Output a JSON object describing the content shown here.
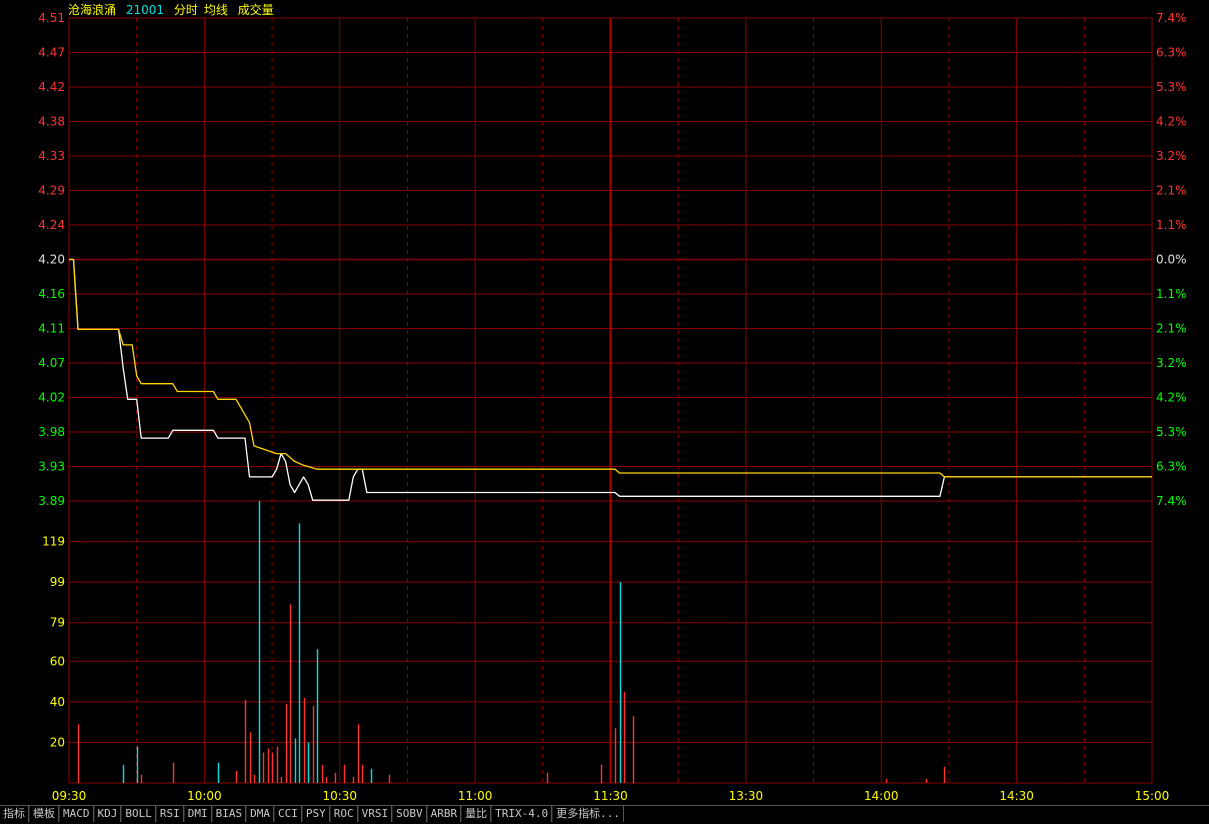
{
  "header": {
    "stock_name": "沧海浪涌",
    "stock_code": "21001",
    "mode": "分时",
    "avg_label": "均线",
    "vol_label": "成交量"
  },
  "tabs": [
    "指标",
    "模板",
    "MACD",
    "KDJ",
    "BOLL",
    "RSI",
    "DMI",
    "BIAS",
    "DMA",
    "CCI",
    "PSY",
    "ROC",
    "VRSI",
    "SOBV",
    "ARBR",
    "量比",
    "TRIX-4.0",
    "更多指标..."
  ],
  "colors": {
    "grid": "#8b0000",
    "up": "#ff3232",
    "down": "#00ff00",
    "flat": "#e0e0e0",
    "price_line": "#ffffff",
    "avg_line": "#ffd700",
    "vol_up": "#ff3232",
    "vol_down": "#00e0e0",
    "time_label": "#ffff00"
  },
  "chart_data": {
    "type": "line",
    "title": "",
    "prev_close": 4.2,
    "price_ticks": [
      "4.51",
      "4.47",
      "4.42",
      "4.38",
      "4.33",
      "4.29",
      "4.24",
      "4.20",
      "4.16",
      "4.11",
      "4.07",
      "4.02",
      "3.98",
      "3.93",
      "3.89"
    ],
    "pct_ticks": [
      "7.4%",
      "6.3%",
      "5.3%",
      "4.2%",
      "3.2%",
      "2.1%",
      "1.1%",
      "0.0%",
      "1.1%",
      "2.1%",
      "3.2%",
      "4.2%",
      "5.3%",
      "6.3%",
      "7.4%"
    ],
    "volume_ticks": [
      "119",
      "99",
      "79",
      "60",
      "40",
      "20"
    ],
    "volume_ylim": [
      0,
      139
    ],
    "price_ylim": [
      3.889,
      4.511
    ],
    "time_labels": [
      "09:30",
      "10:00",
      "10:30",
      "11:00",
      "11:30",
      "13:30",
      "14:00",
      "14:30",
      "15:00"
    ],
    "x_range": [
      0,
      240
    ],
    "series": [
      {
        "values": [
          [
            0,
            4.2
          ],
          [
            1,
            4.2
          ],
          [
            2,
            4.11
          ],
          [
            11,
            4.11
          ],
          [
            12,
            4.06
          ],
          [
            13,
            4.02
          ],
          [
            15,
            4.02
          ],
          [
            16,
            3.97
          ],
          [
            22,
            3.97
          ],
          [
            23,
            3.98
          ],
          [
            32,
            3.98
          ],
          [
            33,
            3.97
          ],
          [
            39,
            3.97
          ],
          [
            40,
            3.92
          ],
          [
            45,
            3.92
          ],
          [
            46,
            3.93
          ],
          [
            47,
            3.95
          ],
          [
            48,
            3.94
          ],
          [
            49,
            3.91
          ],
          [
            50,
            3.9
          ],
          [
            51,
            3.91
          ],
          [
            52,
            3.92
          ],
          [
            53,
            3.91
          ],
          [
            54,
            3.89
          ],
          [
            62,
            3.89
          ],
          [
            63,
            3.92
          ],
          [
            64,
            3.93
          ],
          [
            65,
            3.93
          ],
          [
            66,
            3.9
          ],
          [
            121,
            3.9
          ],
          [
            122,
            3.895
          ],
          [
            193,
            3.895
          ],
          [
            194,
            3.92
          ],
          [
            240,
            3.92
          ]
        ]
      },
      {
        "values": [
          [
            0,
            4.2
          ],
          [
            1,
            4.2
          ],
          [
            2,
            4.11
          ],
          [
            11,
            4.11
          ],
          [
            12,
            4.09
          ],
          [
            14,
            4.09
          ],
          [
            15,
            4.05
          ],
          [
            16,
            4.04
          ],
          [
            23,
            4.04
          ],
          [
            24,
            4.03
          ],
          [
            32,
            4.03
          ],
          [
            33,
            4.02
          ],
          [
            37,
            4.02
          ],
          [
            38,
            4.01
          ],
          [
            39,
            4.0
          ],
          [
            40,
            3.99
          ],
          [
            41,
            3.96
          ],
          [
            46,
            3.95
          ],
          [
            48,
            3.95
          ],
          [
            50,
            3.94
          ],
          [
            52,
            3.935
          ],
          [
            55,
            3.93
          ],
          [
            60,
            3.93
          ],
          [
            121,
            3.93
          ],
          [
            122,
            3.925
          ],
          [
            193,
            3.925
          ],
          [
            194,
            3.92
          ],
          [
            240,
            3.92
          ]
        ]
      }
    ],
    "volume": [
      {
        "x": 2,
        "v": 29,
        "dir": "up"
      },
      {
        "x": 12,
        "v": 9,
        "dir": "down"
      },
      {
        "x": 15,
        "v": 18,
        "dir": "down"
      },
      {
        "x": 16,
        "v": 4,
        "dir": "up"
      },
      {
        "x": 23,
        "v": 10,
        "dir": "up"
      },
      {
        "x": 33,
        "v": 10,
        "dir": "down"
      },
      {
        "x": 37,
        "v": 6,
        "dir": "up"
      },
      {
        "x": 39,
        "v": 41,
        "dir": "up"
      },
      {
        "x": 40,
        "v": 25,
        "dir": "up"
      },
      {
        "x": 41,
        "v": 4,
        "dir": "up"
      },
      {
        "x": 42,
        "v": 139,
        "dir": "down"
      },
      {
        "x": 43,
        "v": 15,
        "dir": "up"
      },
      {
        "x": 44,
        "v": 17,
        "dir": "up"
      },
      {
        "x": 45,
        "v": 15,
        "dir": "up"
      },
      {
        "x": 46,
        "v": 18,
        "dir": "up"
      },
      {
        "x": 47,
        "v": 3,
        "dir": "up"
      },
      {
        "x": 48,
        "v": 39,
        "dir": "up"
      },
      {
        "x": 49,
        "v": 88,
        "dir": "up"
      },
      {
        "x": 50,
        "v": 22,
        "dir": "down"
      },
      {
        "x": 51,
        "v": 128,
        "dir": "down"
      },
      {
        "x": 52,
        "v": 42,
        "dir": "up"
      },
      {
        "x": 53,
        "v": 20,
        "dir": "down"
      },
      {
        "x": 54,
        "v": 38,
        "dir": "up"
      },
      {
        "x": 55,
        "v": 66,
        "dir": "down"
      },
      {
        "x": 56,
        "v": 9,
        "dir": "up"
      },
      {
        "x": 57,
        "v": 3,
        "dir": "up"
      },
      {
        "x": 59,
        "v": 5,
        "dir": "up"
      },
      {
        "x": 61,
        "v": 9,
        "dir": "up"
      },
      {
        "x": 63,
        "v": 3,
        "dir": "up"
      },
      {
        "x": 64,
        "v": 29,
        "dir": "up"
      },
      {
        "x": 65,
        "v": 9,
        "dir": "up"
      },
      {
        "x": 67,
        "v": 7,
        "dir": "down"
      },
      {
        "x": 71,
        "v": 4,
        "dir": "up"
      },
      {
        "x": 106,
        "v": 5,
        "dir": "up"
      },
      {
        "x": 118,
        "v": 9,
        "dir": "up"
      },
      {
        "x": 121,
        "v": 27,
        "dir": "up"
      },
      {
        "x": 122,
        "v": 99,
        "dir": "down"
      },
      {
        "x": 123,
        "v": 45,
        "dir": "up"
      },
      {
        "x": 125,
        "v": 33,
        "dir": "up"
      },
      {
        "x": 181,
        "v": 2,
        "dir": "up"
      },
      {
        "x": 190,
        "v": 2,
        "dir": "up"
      },
      {
        "x": 194,
        "v": 8,
        "dir": "up"
      }
    ]
  }
}
